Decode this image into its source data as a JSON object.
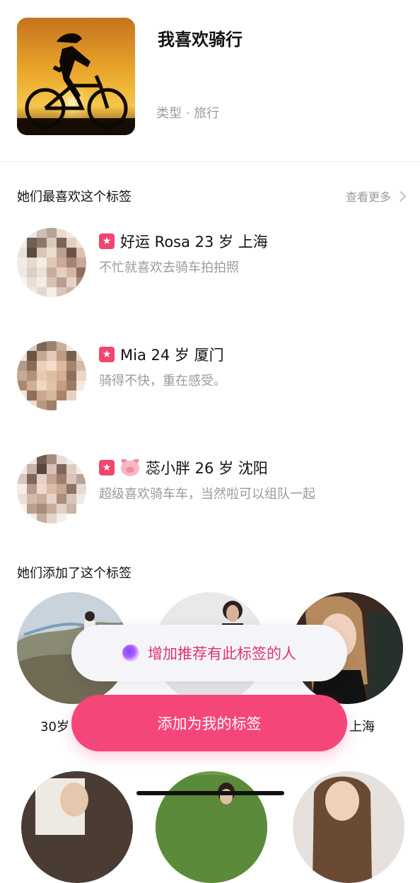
{
  "tag": {
    "title": "我喜欢骑行",
    "type": "类型 · 旅行"
  },
  "liked_section": {
    "title": "她们最喜欢这个标签",
    "more": "查看更多"
  },
  "users": [
    {
      "name_line": "好运 Rosa 23 岁 上海",
      "bio": "不忙就喜欢去骑车拍拍照"
    },
    {
      "name_line": "Mia 24 岁 厦门",
      "bio": "骑得不快，重在感受。"
    },
    {
      "name_line": "蕊小胖 26 岁 沈阳",
      "bio": "超级喜欢骑车车，当然啦可以组队一起"
    }
  ],
  "added_section": {
    "title": "她们添加了这个标签"
  },
  "gallery": {
    "captions": [
      "30岁",
      "上海"
    ]
  },
  "actions": {
    "recommend_label": "增加推荐有此标签的人",
    "add_label": "添加为我的标签"
  },
  "colors": {
    "accent": "#f5467a",
    "accent_text": "#e0346c",
    "muted": "#9a9a9a"
  },
  "icons": [
    "star-badge-icon",
    "pig-emoji-icon",
    "chevron-right-icon",
    "sparkle-orb-icon"
  ]
}
